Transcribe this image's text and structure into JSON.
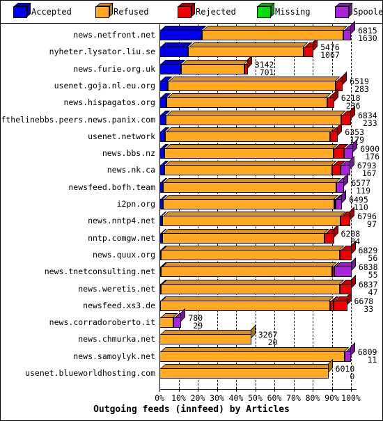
{
  "legend": {
    "items": [
      {
        "label": "Accepted",
        "color": "#0000ee",
        "icon": "cube-icon"
      },
      {
        "label": "Refused",
        "color": "#ffaa22",
        "icon": "cube-icon"
      },
      {
        "label": "Rejected",
        "color": "#ee0000",
        "icon": "cube-icon"
      },
      {
        "label": "Missing",
        "color": "#00dd00",
        "icon": "cube-icon"
      },
      {
        "label": "Spooled",
        "color": "#aa22dd",
        "icon": "cube-icon"
      }
    ]
  },
  "chart_data": {
    "type": "bar",
    "orientation": "horizontal",
    "stacked": true,
    "percent_normalized": true,
    "title": "Outgoing feeds (innfeed) by Articles",
    "xlabel": "Outgoing feeds (innfeed) by Articles",
    "ylabel": "",
    "xlim": [
      0,
      100
    ],
    "xticks": [
      "0%",
      "10%",
      "20%",
      "30%",
      "40%",
      "50%",
      "60%",
      "70%",
      "80%",
      "90%",
      "100%"
    ],
    "grid": true,
    "legend_position": "top",
    "series": [
      {
        "name": "Accepted",
        "color": "#0000ee"
      },
      {
        "name": "Refused",
        "color": "#ffaa22"
      },
      {
        "name": "Rejected",
        "color": "#ee0000"
      },
      {
        "name": "Missing",
        "color": "#00dd00"
      },
      {
        "name": "Spooled",
        "color": "#aa22dd"
      }
    ],
    "categories": [
      "news.netfront.net",
      "nyheter.lysator.liu.se",
      "news.furie.org.uk",
      "usenet.goja.nl.eu.org",
      "news.hispagatos.org",
      "endofthelinebbs.peers.news.panix.com",
      "usenet.network",
      "news.bbs.nz",
      "news.nk.ca",
      "newsfeed.bofh.team",
      "i2pn.org",
      "news.nntp4.net",
      "nntp.comgw.net",
      "news.quux.org",
      "news.tnetconsulting.net",
      "news.weretis.net",
      "newsfeed.xs3.de",
      "news.corradoroberto.it",
      "news.chmurka.net",
      "news.samoylyk.net",
      "usenet.blueworldhosting.com"
    ],
    "rows": [
      {
        "label": "news.netfront.net",
        "total": 6815,
        "value2": 1630,
        "bar_percent": 100,
        "segments": [
          {
            "name": "Accepted",
            "pct": 22.3
          },
          {
            "name": "Refused",
            "pct": 73.7
          },
          {
            "name": "Spooled",
            "pct": 4.0
          }
        ]
      },
      {
        "label": "nyheter.lysator.liu.se",
        "total": 5476,
        "value2": 1067,
        "bar_percent": 80.4,
        "segments": [
          {
            "name": "Accepted",
            "pct": 14.8
          },
          {
            "name": "Refused",
            "pct": 60.5
          },
          {
            "name": "Rejected",
            "pct": 5.1
          }
        ]
      },
      {
        "label": "news.furie.org.uk",
        "total": 3142,
        "value2": 701,
        "bar_percent": 46.1,
        "segments": [
          {
            "name": "Accepted",
            "pct": 11.3
          },
          {
            "name": "Refused",
            "pct": 33.0
          },
          {
            "name": "Rejected",
            "pct": 1.8
          }
        ]
      },
      {
        "label": "usenet.goja.nl.eu.org",
        "total": 6519,
        "value2": 283,
        "bar_percent": 95.7,
        "segments": [
          {
            "name": "Accepted",
            "pct": 4.3
          },
          {
            "name": "Refused",
            "pct": 87.6
          },
          {
            "name": "Rejected",
            "pct": 3.8
          }
        ]
      },
      {
        "label": "news.hispagatos.org",
        "total": 6218,
        "value2": 236,
        "bar_percent": 91.2,
        "segments": [
          {
            "name": "Accepted",
            "pct": 3.7
          },
          {
            "name": "Refused",
            "pct": 83.8
          },
          {
            "name": "Rejected",
            "pct": 3.7
          }
        ]
      },
      {
        "label": "endofthelinebbs.peers.news.panix.com",
        "total": 6834,
        "value2": 233,
        "bar_percent": 100,
        "segments": [
          {
            "name": "Accepted",
            "pct": 3.4
          },
          {
            "name": "Refused",
            "pct": 91.6
          },
          {
            "name": "Rejected",
            "pct": 5.0
          }
        ]
      },
      {
        "label": "usenet.network",
        "total": 6353,
        "value2": 179,
        "bar_percent": 93.2,
        "segments": [
          {
            "name": "Accepted",
            "pct": 2.8
          },
          {
            "name": "Refused",
            "pct": 86.4
          },
          {
            "name": "Rejected",
            "pct": 4.0
          }
        ]
      },
      {
        "label": "news.bbs.nz",
        "total": 6900,
        "value2": 176,
        "bar_percent": 101.2,
        "segments": [
          {
            "name": "Accepted",
            "pct": 2.6
          },
          {
            "name": "Refused",
            "pct": 88.2
          },
          {
            "name": "Rejected",
            "pct": 5.4
          },
          {
            "name": "Spooled",
            "pct": 5.0
          }
        ]
      },
      {
        "label": "news.nk.ca",
        "total": 6793,
        "value2": 167,
        "bar_percent": 99.6,
        "segments": [
          {
            "name": "Accepted",
            "pct": 2.5
          },
          {
            "name": "Refused",
            "pct": 87.5
          },
          {
            "name": "Rejected",
            "pct": 4.6
          },
          {
            "name": "Spooled",
            "pct": 5.0
          }
        ]
      },
      {
        "label": "newsfeed.bofh.team",
        "total": 6577,
        "value2": 119,
        "bar_percent": 96.5,
        "segments": [
          {
            "name": "Accepted",
            "pct": 1.8
          },
          {
            "name": "Refused",
            "pct": 90.7
          },
          {
            "name": "Spooled",
            "pct": 4.0
          }
        ]
      },
      {
        "label": "i2pn.org",
        "total": 6495,
        "value2": 110,
        "bar_percent": 95.3,
        "segments": [
          {
            "name": "Accepted",
            "pct": 1.7
          },
          {
            "name": "Refused",
            "pct": 89.6
          },
          {
            "name": "Rejected",
            "pct": 0.6
          },
          {
            "name": "Spooled",
            "pct": 3.4
          }
        ]
      },
      {
        "label": "news.nntp4.net",
        "total": 6796,
        "value2": 97,
        "bar_percent": 99.7,
        "segments": [
          {
            "name": "Accepted",
            "pct": 1.4
          },
          {
            "name": "Refused",
            "pct": 93.3
          },
          {
            "name": "Rejected",
            "pct": 5.0
          }
        ]
      },
      {
        "label": "nntp.comgw.net",
        "total": 6208,
        "value2": 84,
        "bar_percent": 91.1,
        "segments": [
          {
            "name": "Accepted",
            "pct": 1.3
          },
          {
            "name": "Refused",
            "pct": 84.8
          },
          {
            "name": "Rejected",
            "pct": 5.0
          }
        ]
      },
      {
        "label": "news.quux.org",
        "total": 6829,
        "value2": 56,
        "bar_percent": 100.2,
        "segments": [
          {
            "name": "Accepted",
            "pct": 0.8
          },
          {
            "name": "Refused",
            "pct": 93.4
          },
          {
            "name": "Rejected",
            "pct": 6.0
          }
        ]
      },
      {
        "label": "news.tnetconsulting.net",
        "total": 6838,
        "value2": 55,
        "bar_percent": 100.3,
        "segments": [
          {
            "name": "Accepted",
            "pct": 0.8
          },
          {
            "name": "Refused",
            "pct": 89.5
          },
          {
            "name": "Rejected",
            "pct": 1.0
          },
          {
            "name": "Spooled",
            "pct": 9.0
          }
        ]
      },
      {
        "label": "news.weretis.net",
        "total": 6837,
        "value2": 47,
        "bar_percent": 100.3,
        "segments": [
          {
            "name": "Accepted",
            "pct": 0.7
          },
          {
            "name": "Refused",
            "pct": 93.6
          },
          {
            "name": "Rejected",
            "pct": 6.0
          }
        ]
      },
      {
        "label": "newsfeed.xs3.de",
        "total": 6678,
        "value2": 33,
        "bar_percent": 98.0,
        "segments": [
          {
            "name": "Accepted",
            "pct": 0.5
          },
          {
            "name": "Refused",
            "pct": 88.5
          },
          {
            "name": "Rejected",
            "pct": 2.0
          },
          {
            "name": "Rejected",
            "pct": 7.0
          }
        ]
      },
      {
        "label": "news.corradoroberto.it",
        "total": 780,
        "value2": 29,
        "bar_percent": 11.4,
        "segments": [
          {
            "name": "Refused",
            "pct": 7.4
          },
          {
            "name": "Spooled",
            "pct": 4.0
          }
        ]
      },
      {
        "label": "news.chmurka.net",
        "total": 3267,
        "value2": 20,
        "bar_percent": 47.9,
        "segments": [
          {
            "name": "Refused",
            "pct": 47.9
          }
        ]
      },
      {
        "label": "news.samoylyk.net",
        "total": 6809,
        "value2": 11,
        "bar_percent": 99.9,
        "segments": [
          {
            "name": "Refused",
            "pct": 96.9
          },
          {
            "name": "Spooled",
            "pct": 3.0
          }
        ]
      },
      {
        "label": "usenet.blueworldhosting.com",
        "total": 6010,
        "value2": 0,
        "bar_percent": 88.2,
        "segments": [
          {
            "name": "Refused",
            "pct": 88.2
          }
        ]
      }
    ]
  }
}
